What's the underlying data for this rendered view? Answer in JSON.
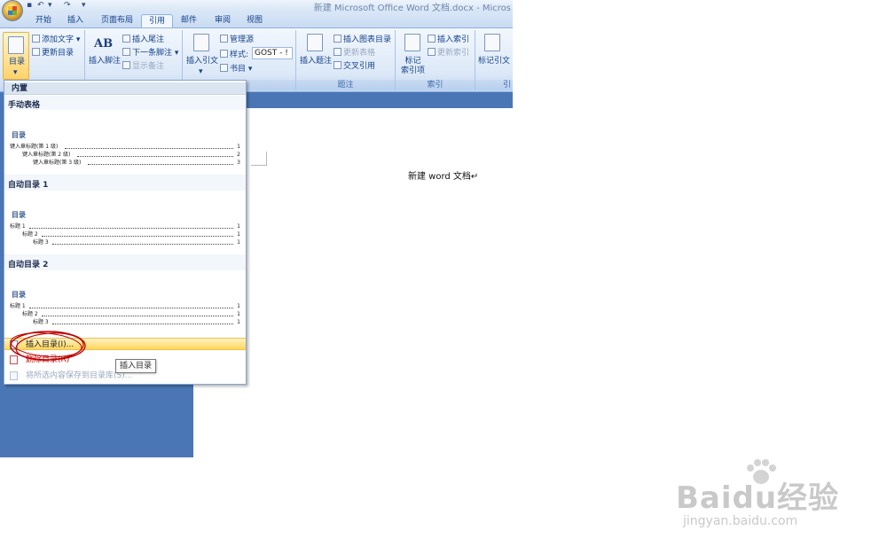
{
  "window": {
    "title": "新建 Microsoft Office Word 文档.docx - Micros"
  },
  "tabs": [
    {
      "label": "开始"
    },
    {
      "label": "插入"
    },
    {
      "label": "页面布局"
    },
    {
      "label": "引用"
    },
    {
      "label": "邮件"
    },
    {
      "label": "审阅"
    },
    {
      "label": "视图"
    }
  ],
  "active_tab": "引用",
  "ribbon": {
    "toc_group": {
      "toc_button": "目录",
      "add_text": "添加文字",
      "update_toc": "更新目录"
    },
    "footnotes_group": {
      "insert_footnote": "插入脚注",
      "insert_endnote": "插入尾注",
      "next_footnote": "下一条脚注",
      "show_notes": "显示备注",
      "ab_icon_text": "AB"
    },
    "citations_group": {
      "insert_citation": "插入引文",
      "manage_sources": "管理源",
      "style_label": "样式:",
      "style_value": "GOST - !",
      "bibliography": "书目",
      "label": "书目"
    },
    "captions_group": {
      "insert_caption": "插入题注",
      "insert_table_of_figures": "插入图表目录",
      "update_table": "更新表格",
      "cross_reference": "交叉引用",
      "label": "题注"
    },
    "index_group": {
      "mark_entry": "标记\n索引项",
      "insert_index": "插入索引",
      "update_index": "更新索引",
      "label": "索引"
    },
    "toa_group": {
      "mark_citation": "标记引文",
      "label": "引"
    }
  },
  "gallery": {
    "header": "内置",
    "entries": [
      {
        "title": "手动表格",
        "heading": "目录",
        "lines": [
          {
            "text": "键入章标题(第 1 级)",
            "page": "1"
          },
          {
            "text": "键入章标题(第 2 级)",
            "page": "2"
          },
          {
            "text": "键入章标题(第 3 级)",
            "page": "3"
          }
        ]
      },
      {
        "title": "自动目录 1",
        "heading": "目录",
        "lines": [
          {
            "text": "标题 1",
            "page": "1"
          },
          {
            "text": "标题 2",
            "page": "1"
          },
          {
            "text": "标题 3",
            "page": "1"
          }
        ]
      },
      {
        "title": "自动目录 2",
        "heading": "目录",
        "lines": [
          {
            "text": "标题 1",
            "page": "1"
          },
          {
            "text": "标题 2",
            "page": "1"
          },
          {
            "text": "标题 3",
            "page": "1"
          }
        ]
      }
    ],
    "menu": {
      "insert_toc": "插入目录(I)...",
      "remove_toc": "删除目录(R)",
      "save_selection": "将所选内容保存到目录库(S)..."
    }
  },
  "tooltip": "插入目录",
  "document": {
    "text": "新建 word 文档↵"
  },
  "watermark": {
    "brand": "Baidu经验",
    "url": "jingyan.baidu.com"
  },
  "colors": {
    "ribbon_bg": "#dde9f8",
    "sidebar": "#4a76b5",
    "highlight": "#ffd65b",
    "annotation": "#c00000"
  }
}
